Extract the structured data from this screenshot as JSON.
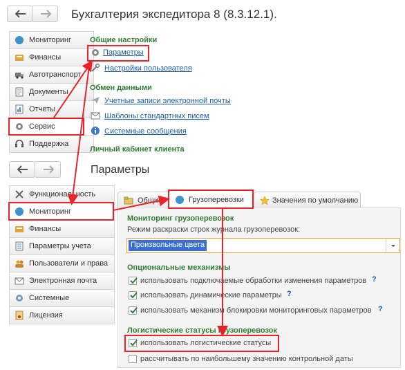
{
  "top": {
    "window_title": "Бухгалтерия экспедитора 8 (8.3.12.1).",
    "sidebar": [
      {
        "label": "Мониторинг",
        "icon": "globe-icon"
      },
      {
        "label": "Финансы",
        "icon": "finance-icon"
      },
      {
        "label": "Автотранспорт",
        "icon": "truck-icon"
      },
      {
        "label": "Документы",
        "icon": "document-icon"
      },
      {
        "label": "Отчеты",
        "icon": "report-icon"
      },
      {
        "label": "Сервис",
        "icon": "gear-icon"
      },
      {
        "label": "Поддержка",
        "icon": "headset-icon"
      }
    ],
    "sections": {
      "general_title": "Общие настройки",
      "parameters_link": "Параметры",
      "user_settings_link": "Настройки пользователя",
      "exchange_title": "Обмен данными",
      "email_accounts_link": "Учетные записи электронной почты",
      "templates_link": "Шаблоны стандартных писем",
      "system_messages_link": "Системные сообщения",
      "cabinet_title": "Личный кабинет клиента"
    }
  },
  "bottom": {
    "window_title": "Параметры",
    "sidebar": [
      {
        "label": "Функциональность",
        "icon": "tools-icon"
      },
      {
        "label": "Мониторинг",
        "icon": "globe-icon"
      },
      {
        "label": "Финансы",
        "icon": "finance-icon"
      },
      {
        "label": "Параметры учета",
        "icon": "list-icon"
      },
      {
        "label": "Пользователи и права",
        "icon": "users-icon"
      },
      {
        "label": "Электронная почта",
        "icon": "mail-icon"
      },
      {
        "label": "Системные",
        "icon": "system-icon"
      },
      {
        "label": "Лицензия",
        "icon": "license-icon"
      }
    ],
    "tabs": {
      "general": "Общие",
      "cargo": "Грузоперевозки",
      "defaults": "Значения по умолчанию"
    },
    "monitoring": {
      "title": "Мониторинг грузоперевозок",
      "color_mode_label": "Режим раскраски строк журнала грузоперевозок:",
      "color_mode_value": "Произвольные цвета"
    },
    "optional": {
      "title": "Опциональные механизмы",
      "items": [
        {
          "label": "использовать подключаемые обработки изменения параметров",
          "checked": true,
          "help": "?"
        },
        {
          "label": "использовать динамические параметры",
          "checked": true,
          "help": "?"
        },
        {
          "label": "использовать механизм блокировки мониторинговых параметров",
          "checked": true,
          "help": "?"
        }
      ]
    },
    "logistics": {
      "title": "Логистические статусы грузоперевозок",
      "items": [
        {
          "label": "использовать логистические статусы",
          "checked": true
        },
        {
          "label": "рассчитывать  по наибольшему значению контрольной даты",
          "checked": false
        }
      ]
    }
  },
  "colors": {
    "accent_green": "#2e7d32",
    "link_blue": "#1f5da8",
    "highlight_red": "#e8242b",
    "selection_blue": "#3b6fcf"
  }
}
